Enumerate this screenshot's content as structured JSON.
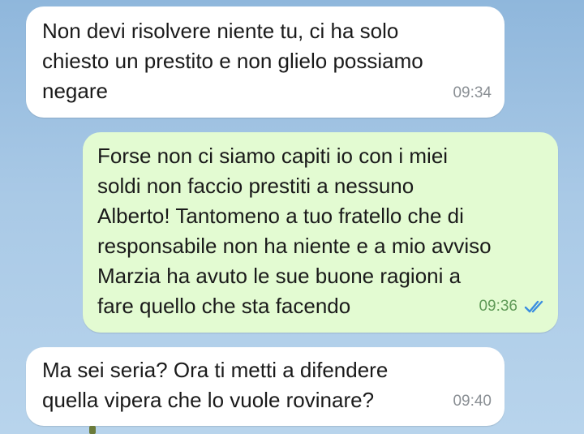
{
  "messages": [
    {
      "direction": "incoming",
      "text": "Non devi risolvere niente tu, ci ha solo\nchiesto un prestito e non glielo possiamo\nnegare",
      "time": "09:34"
    },
    {
      "direction": "outgoing",
      "text": "Forse non ci siamo capiti io con i miei\nsoldi non faccio prestiti a nessuno\nAlberto! Tantomeno a tuo fratello che di\nresponsabile non ha niente e a mio avviso\nMarzia ha avuto le sue buone ragioni a\nfare quello che sta facendo",
      "time": "09:36",
      "status_icon": "double-check-icon",
      "status_color": "#3b8ee0"
    },
    {
      "direction": "incoming",
      "text": "Ma sei seria? Ora ti metti a difendere\nquella vipera che lo vuole rovinare?",
      "time": "09:40"
    }
  ],
  "colors": {
    "incoming_bubble": "#ffffff",
    "outgoing_bubble": "#e3fbd2",
    "read_ticks": "#3b8ee0"
  }
}
